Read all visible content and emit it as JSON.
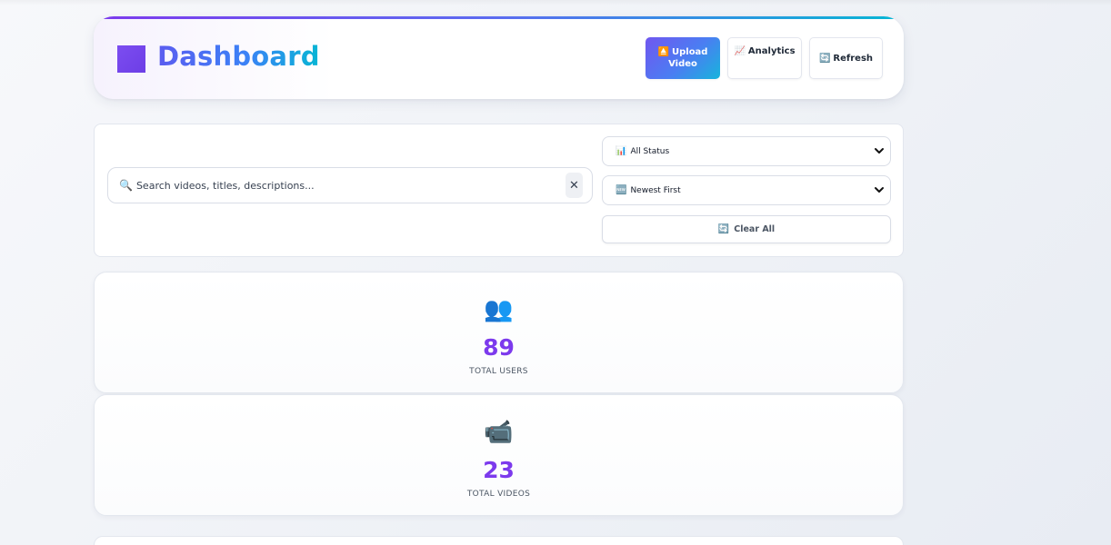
{
  "header": {
    "title": "Dashboard",
    "buttons": {
      "upload": {
        "icon": "⏏️",
        "label_line1": "Upload",
        "label_line2": "Video"
      },
      "analytics": {
        "icon": "📈",
        "label": "Analytics"
      },
      "refresh": {
        "icon": "🔄",
        "label": "Refresh"
      }
    }
  },
  "filters": {
    "search": {
      "icon": "🔍",
      "placeholder": "Search videos, titles, descriptions...",
      "clear_symbol": "✕"
    },
    "status_select": {
      "icon": "📊",
      "value": "All Status"
    },
    "sort_select": {
      "icon": "🆕",
      "value": "Newest First"
    },
    "clear_all": {
      "icon": "🔄",
      "label": "Clear All"
    }
  },
  "stats": [
    {
      "icon": "👥",
      "value": "89",
      "label": "TOTAL USERS"
    },
    {
      "icon": "📹",
      "value": "23",
      "label": "TOTAL VIDEOS"
    }
  ],
  "colors": {
    "accent_purple": "#7c3aed",
    "gradient_start": "#7057f0",
    "gradient_end": "#17b4dc"
  }
}
